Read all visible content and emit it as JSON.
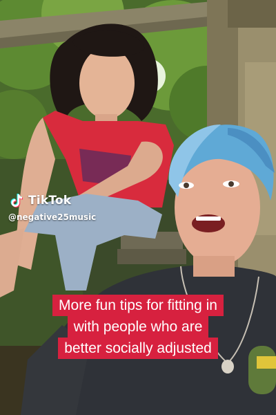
{
  "watermark": {
    "brand": "TikTok",
    "handle": "@negative25music",
    "icon": "tiktok-logo-icon"
  },
  "caption": {
    "lines": [
      "More fun tips for fitting in",
      "with people who are",
      "better socially adjusted"
    ],
    "background_color": "#d7213f",
    "text_color": "#ffffff"
  }
}
